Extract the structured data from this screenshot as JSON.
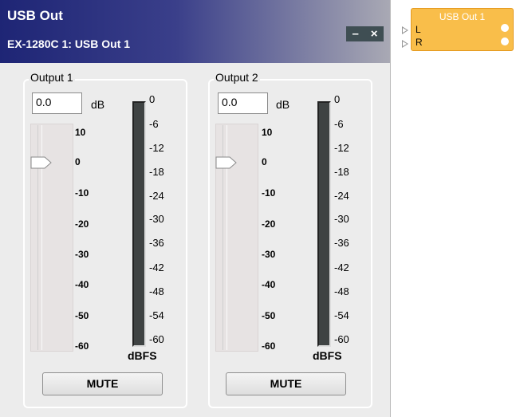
{
  "window": {
    "title": "USB Out",
    "subtitle": "EX-1280C 1: USB Out 1",
    "minimize_label": "–",
    "close_label": "×"
  },
  "outputs": [
    {
      "label": "Output 1",
      "value": "0.0",
      "unit": "dB",
      "fader_level_db": 0,
      "fader_scale": [
        "10",
        "0",
        "-10",
        "-20",
        "-30",
        "-40",
        "-50",
        "-60"
      ],
      "meter_scale": [
        "0",
        "-6",
        "-12",
        "-18",
        "-24",
        "-30",
        "-36",
        "-42",
        "-48",
        "-54",
        "-60"
      ],
      "meter_unit": "dBFS",
      "mute_label": "MUTE"
    },
    {
      "label": "Output 2",
      "value": "0.0",
      "unit": "dB",
      "fader_level_db": 0,
      "fader_scale": [
        "10",
        "0",
        "-10",
        "-20",
        "-30",
        "-40",
        "-50",
        "-60"
      ],
      "meter_scale": [
        "0",
        "-6",
        "-12",
        "-18",
        "-24",
        "-30",
        "-36",
        "-42",
        "-48",
        "-54",
        "-60"
      ],
      "meter_unit": "dBFS",
      "mute_label": "MUTE"
    }
  ],
  "node": {
    "title": "USB Out 1",
    "port_left": "L",
    "port_right": "R",
    "color": "#f9be4a"
  }
}
